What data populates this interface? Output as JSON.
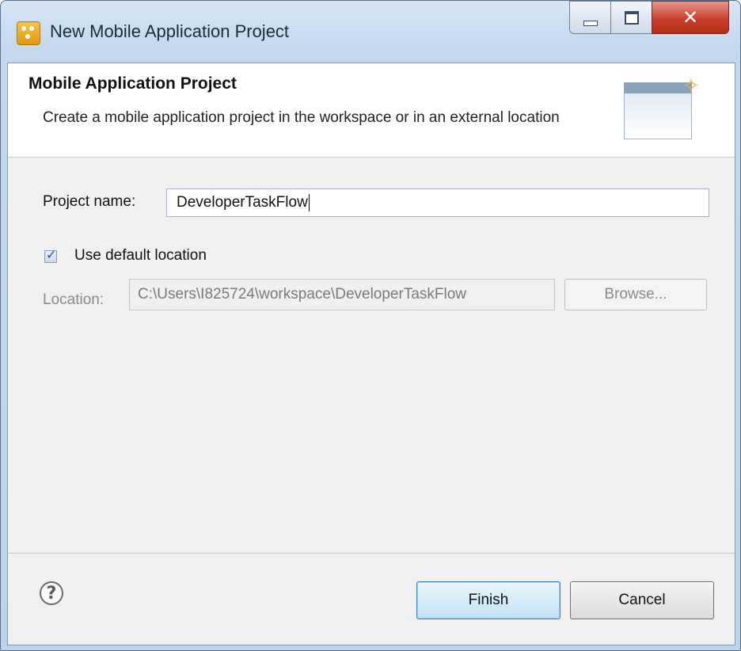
{
  "window": {
    "title": "New Mobile Application Project"
  },
  "header": {
    "title": "Mobile Application Project",
    "description": "Create a mobile application project in the workspace or in an external location"
  },
  "form": {
    "project_name_label": "Project name:",
    "project_name_value": "DeveloperTaskFlow",
    "use_default_label": "Use default location",
    "use_default_checked": true,
    "location_label": "Location:",
    "location_value": "C:\\Users\\I825724\\workspace\\DeveloperTaskFlow",
    "browse_label": "Browse..."
  },
  "footer": {
    "finish_label": "Finish",
    "cancel_label": "Cancel",
    "help_glyph": "?"
  }
}
